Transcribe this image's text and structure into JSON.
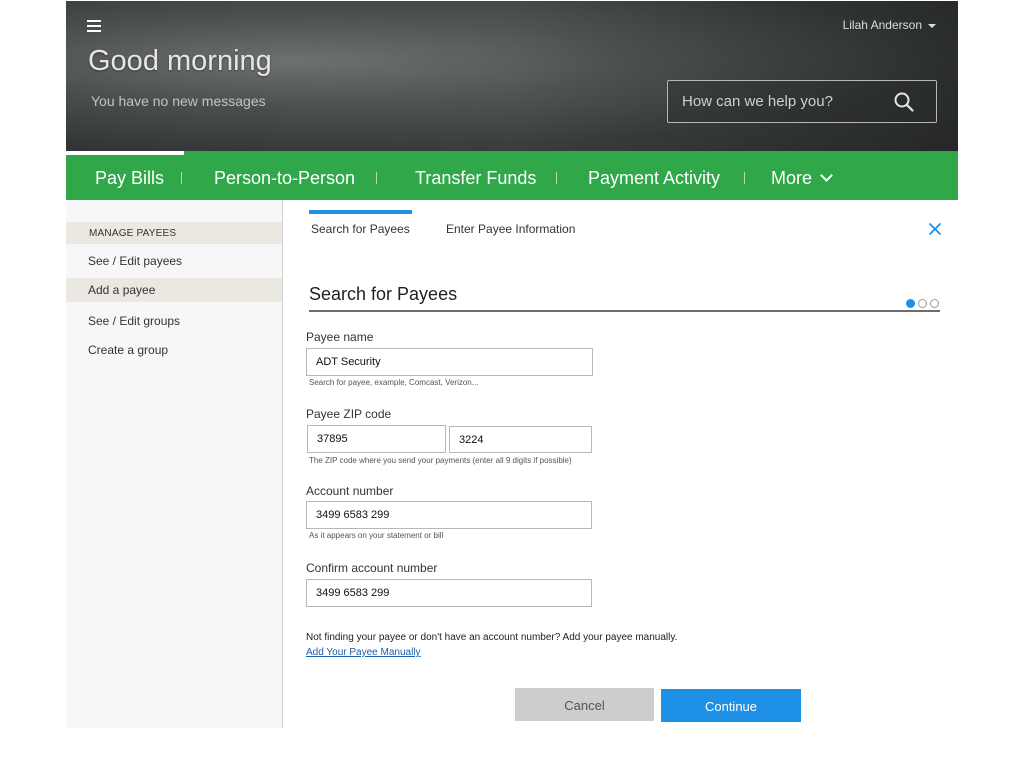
{
  "header": {
    "greeting": "Good morning",
    "messages": "You have no new messages",
    "user_name": "Lilah Anderson",
    "search_placeholder": "How can we help you?"
  },
  "nav": {
    "items": [
      "Pay Bills",
      "Person-to-Person",
      "Transfer Funds",
      "Payment Activity",
      "More"
    ],
    "active": "Pay Bills"
  },
  "sidebar": {
    "heading": "MANAGE PAYEES",
    "items": [
      "See / Edit payees",
      "Add a payee",
      "See / Edit groups",
      "Create a group"
    ],
    "selected": "Add a payee"
  },
  "tabs": [
    "Search for Payees",
    "Enter Payee Information"
  ],
  "form": {
    "title": "Search for Payees",
    "payee_name_label": "Payee name",
    "payee_name_value": "ADT Security",
    "payee_name_hint": "Search for payee, example, Comcast, Verizon...",
    "zip_label": "Payee ZIP code",
    "zip_value": "37895",
    "zip_ext_value": "3224",
    "zip_hint": "The ZIP code where you send your payments (enter all 9 digits if possible)",
    "account_label": "Account number",
    "account_value": "3499 6583 299",
    "account_hint": "As it appears on your statement or bill",
    "confirm_label": "Confirm account number",
    "confirm_value": "3499 6583 299",
    "not_found_text": "Not finding your payee or don't have an account number?  Add your payee manually.",
    "manual_link": "Add Your Payee Manually",
    "cancel_label": "Cancel",
    "continue_label": "Continue"
  },
  "steps": {
    "current": 1,
    "total": 3
  },
  "colors": {
    "nav_green": "#30a84a",
    "accent_blue": "#1e90e6"
  }
}
